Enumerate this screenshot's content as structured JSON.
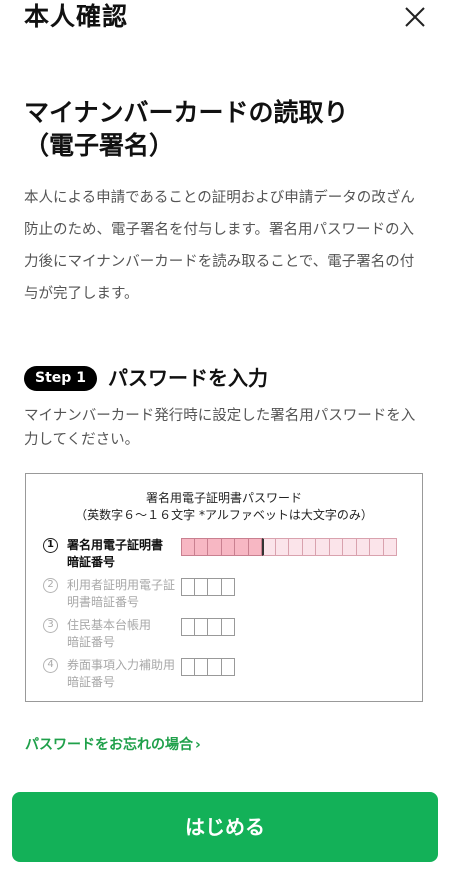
{
  "header": {
    "title": "本人確認",
    "close_icon": "close-icon"
  },
  "title": {
    "line1": "マイナンバーカードの読取り",
    "line2": "（電子署名）"
  },
  "description": "本人による申請であることの証明および申請データの改ざん防止のため、電子署名を付与します。署名用パスワードの入力後にマイナンバーカードを読み取ることで、電子署名の付与が完了します。",
  "step": {
    "badge": "Step 1",
    "title": "パスワードを入力",
    "description": "マイナンバーカード発行時に設定した署名用パスワードを入力してください。"
  },
  "password_box": {
    "title_line1": "署名用電子証明書パスワード",
    "title_line2": "（英数字６～１６文字 *アルファベットは大文字のみ）",
    "rows": [
      {
        "num": "1",
        "line1": "署名用電子証明書",
        "line2": "暗証番号",
        "active": true,
        "cell_count": 16
      },
      {
        "num": "2",
        "line1": "利用者証明用電子証",
        "line2": "明書暗証番号",
        "active": false,
        "cell_count": 4
      },
      {
        "num": "3",
        "line1": "住民基本台帳用",
        "line2": "暗証番号",
        "active": false,
        "cell_count": 4
      },
      {
        "num": "4",
        "line1": "券面事項入力補助用",
        "line2": "暗証番号",
        "active": false,
        "cell_count": 4
      }
    ]
  },
  "forgot_link": {
    "label": "パスワードをお忘れの場合",
    "chevron": "›"
  },
  "start_button": {
    "label": "はじめる"
  },
  "colors": {
    "accent_green": "#13b158",
    "link_green": "#1fa04a",
    "highlight_pink": "#f7b7c3"
  }
}
